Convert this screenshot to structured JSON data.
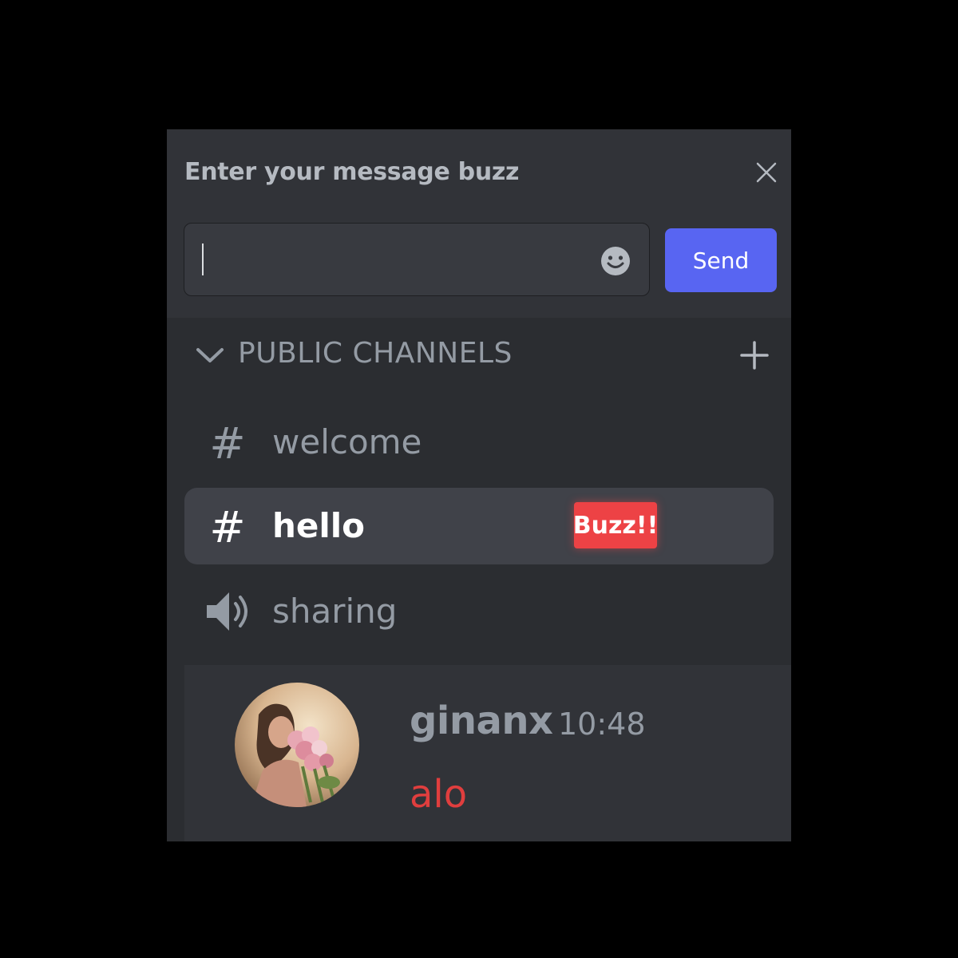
{
  "dialog": {
    "title": "Enter your message buzz",
    "close_icon": "close-icon"
  },
  "composer": {
    "input_value": "",
    "placeholder": "",
    "emoji_icon": "emoji-smile-icon",
    "send_label": "Send"
  },
  "channels_section": {
    "label": "PUBLIC CHANNELS",
    "collapse_icon": "chevron-down-icon",
    "add_icon": "plus-icon",
    "items": [
      {
        "name": "welcome",
        "type": "text",
        "icon": "#"
      },
      {
        "name": "hello",
        "type": "text",
        "icon": "#",
        "selected": true,
        "badge": "Buzz!!"
      },
      {
        "name": "sharing",
        "type": "voice",
        "icon": "speaker-icon"
      }
    ]
  },
  "message": {
    "author": "ginanx",
    "time": "10:48",
    "text": "alo",
    "avatar_icon": "user-avatar"
  },
  "colors": {
    "background": "#000000",
    "panel": "#2b2d31",
    "accent": "#5865f2",
    "badge": "#ed4245",
    "message_text": "#e03e3e"
  }
}
